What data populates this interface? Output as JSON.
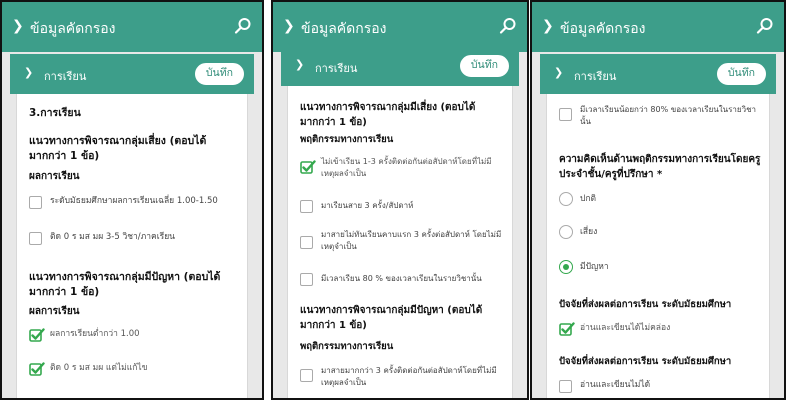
{
  "header": {
    "title": "ข้อมูลคัดกรอง"
  },
  "section": {
    "label": "การเรียน",
    "save_label": "บันทึก"
  },
  "panel1": {
    "heading": "3.การเรียน",
    "group1_title": "แนวทางการพิจารณากลุ่มเสี่ยง (ตอบได้มากกว่า 1 ข้อ)",
    "group1_sub": "ผลการเรียน",
    "group1_options": [
      {
        "label": "ระดับมัธยมศึกษาผลการเรียนเฉลี่ย 1.00-1.50",
        "checked": false
      },
      {
        "label": "ติด 0 ร มส มผ 3-5 วิชา/ภาคเรียน",
        "checked": false
      }
    ],
    "group2_title": "แนวทางการพิจารณากลุ่มมีปัญหา (ตอบได้มากกว่า 1 ข้อ)",
    "group2_sub": "ผลการเรียน",
    "group2_options": [
      {
        "label": "ผลการเรียนต่ำกว่า 1.00",
        "checked": true
      },
      {
        "label": "ติด 0 ร มส มผ แต่ไม่แก้ไข",
        "checked": true
      }
    ]
  },
  "panel2": {
    "group1_title": "แนวทางการพิจารณากลุ่มมีเสี่ยง (ตอบได้มากกว่า 1 ข้อ)",
    "group1_sub": "พฤติกรรมทางการเรียน",
    "group1_options": [
      {
        "label": "ไม่เข้าเรียน 1-3 ครั้งติดต่อกันต่อสัปดาห์โดยที่ไม่มีเหตุผลจำเป็น",
        "checked": true
      },
      {
        "label": "มาเรียนสาย 3 ครั้ง/สัปดาห์",
        "checked": false
      },
      {
        "label": "มาสายไม่ทันเรียนคาบแรก 3 ครั้งต่อสัปดาห์ โดยไม่มีเหตุจำเป็น",
        "checked": false
      },
      {
        "label": "มีเวลาเรียน 80 % ของเวลาเรียนในรายวิชานั้น",
        "checked": false
      }
    ],
    "group2_title": "แนวทางการพิจารณากลุ่มมีปัญหา (ตอบได้มากกว่า 1 ข้อ)",
    "group2_sub": "พฤติกรรมทางการเรียน",
    "group2_options": [
      {
        "label": "มาสายมากกว่า 3 ครั้งติดต่อกันต่อสัปดาห์โดยที่ไม่มีเหตุผลจำเป็น",
        "checked": false
      }
    ]
  },
  "panel3": {
    "top_option": {
      "label": "มีเวลาเรียนน้อยกว่า 80% ของเวลาเรียนในรายวิชานั้น",
      "checked": false
    },
    "opinion_title": "ความคิดเห็นด้านพฤติกรรมทางการเรียนโดยครูประจำชั้น/ครูที่ปรึกษา *",
    "radio_options": [
      {
        "label": "ปกติ",
        "selected": false
      },
      {
        "label": "เสี่ยง",
        "selected": false
      },
      {
        "label": "มีปัญหา",
        "selected": true
      }
    ],
    "factor1_title": "ปัจจัยที่ส่งผลต่อการเรียน ระดับมัธยมศึกษา",
    "factor1_option": {
      "label": "อ่านและเขียนได้ไม่คล่อง",
      "checked": true
    },
    "factor2_title": "ปัจจัยที่ส่งผลต่อการเรียน ระดับมัธยมศึกษา",
    "factor2_option": {
      "label": "อ่านและเขียนไม่ได้",
      "checked": false
    }
  },
  "colors": {
    "header": "#3d9e8a",
    "check": "#34a84e",
    "save_text": "#2f8c78"
  },
  "icons": [
    "chevron-down-icon",
    "search-icon",
    "checkbox-icon",
    "checkmark-icon",
    "radio-icon"
  ]
}
